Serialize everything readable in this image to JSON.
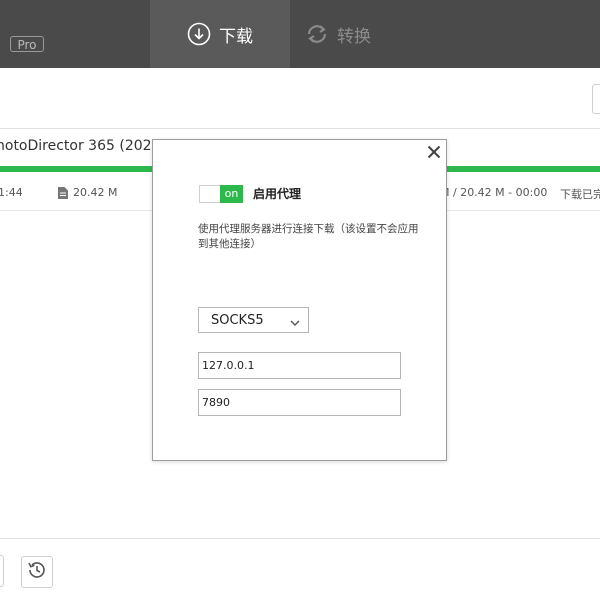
{
  "header": {
    "pro_badge": "Pro",
    "tabs": [
      {
        "label": "下载",
        "icon": "download-circle-icon",
        "active": true
      },
      {
        "label": "转换",
        "icon": "convert-arrows-icon",
        "active": false
      }
    ]
  },
  "download_item": {
    "title": "notoDirector 365 (2021) -",
    "time": "1:44",
    "size": "20.42 M",
    "speed_info": "M / 20.42 M - 00:00",
    "status": "下载已完",
    "progress": 1.0
  },
  "proxy_dialog": {
    "toggle_text": "on",
    "toggle_label": "启用代理",
    "description": "使用代理服务器进行连接下载（该设置不会应用到其他连接）",
    "protocol": "SOCKS5",
    "host": "127.0.0.1",
    "port": "7890"
  },
  "colors": {
    "header_bg": "#4a4a4a",
    "active_tab_bg": "#5a5a5a",
    "accent_green": "#2db84c"
  }
}
